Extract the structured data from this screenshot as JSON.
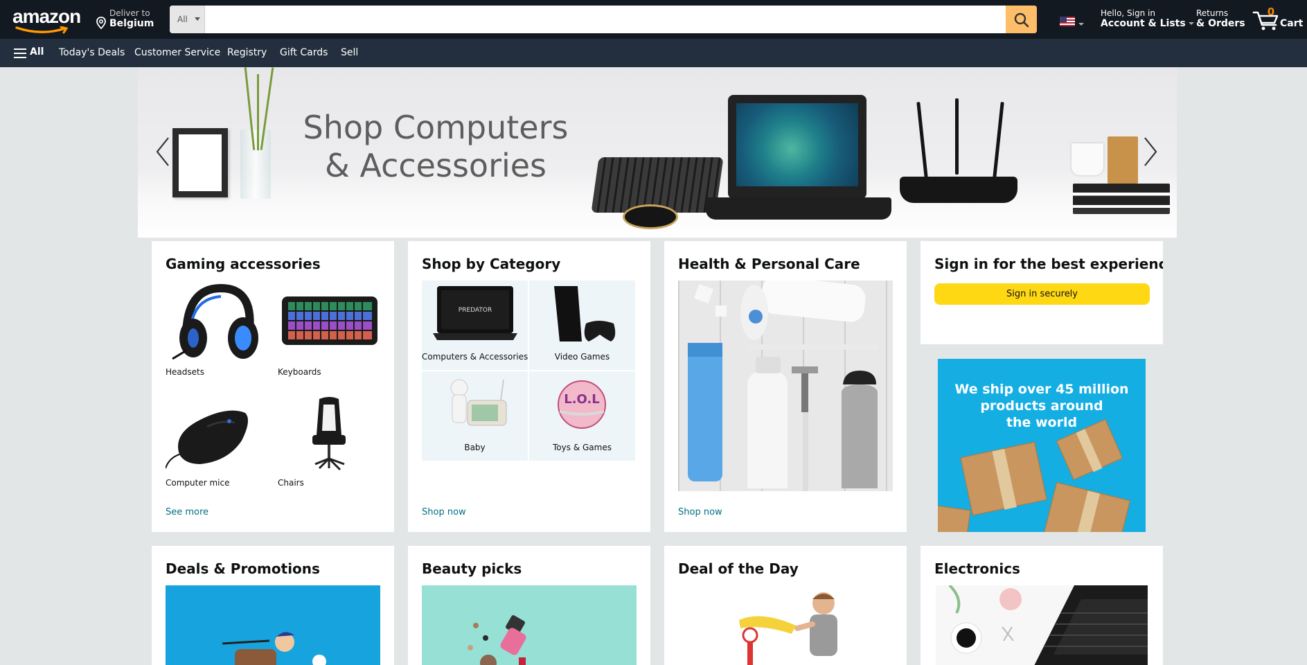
{
  "header": {
    "logo_text": "amazon",
    "deliver_line1": "Deliver to",
    "deliver_line2": "Belgium",
    "search_category": "All",
    "search_placeholder": "",
    "account_line1": "Hello, Sign in",
    "account_line2": "Account & Lists",
    "returns_line1": "Returns",
    "returns_line2": "& Orders",
    "cart_count": "0",
    "cart_label": "Cart"
  },
  "subnav": {
    "all_label": "All",
    "links": [
      "Today's Deals",
      "Customer Service",
      "Registry",
      "Gift Cards",
      "Sell"
    ]
  },
  "hero": {
    "title_line1": "Shop Computers",
    "title_line2": "& Accessories"
  },
  "cards": {
    "gaming": {
      "title": "Gaming accessories",
      "items": [
        "Headsets",
        "Keyboards",
        "Computer mice",
        "Chairs"
      ],
      "link": "See more"
    },
    "category": {
      "title": "Shop by Category",
      "items": [
        "Computers & Accessories",
        "Video Games",
        "Baby",
        "Toys & Games"
      ],
      "link": "Shop now"
    },
    "health": {
      "title": "Health & Personal Care",
      "link": "Shop now"
    },
    "signin": {
      "title": "Sign in for the best experience",
      "button": "Sign in securely"
    },
    "ship_ad": {
      "line1": "We ship over 45 million",
      "line2": "products around",
      "line3": "the world"
    },
    "deals": {
      "title": "Deals & Promotions"
    },
    "beauty": {
      "title": "Beauty picks"
    },
    "deal_day": {
      "title": "Deal of the Day"
    },
    "electronics": {
      "title": "Electronics"
    }
  },
  "colors": {
    "nav_dark": "#131921",
    "nav_sub": "#232f3e",
    "search_button": "#febd69",
    "signin_button": "#ffd814",
    "link": "#007185",
    "cart_count": "#f08804"
  },
  "icons": [
    "location-pin-icon",
    "search-icon",
    "us-flag-icon",
    "cart-icon",
    "hamburger-menu-icon",
    "chevron-left-icon",
    "chevron-right-icon"
  ]
}
